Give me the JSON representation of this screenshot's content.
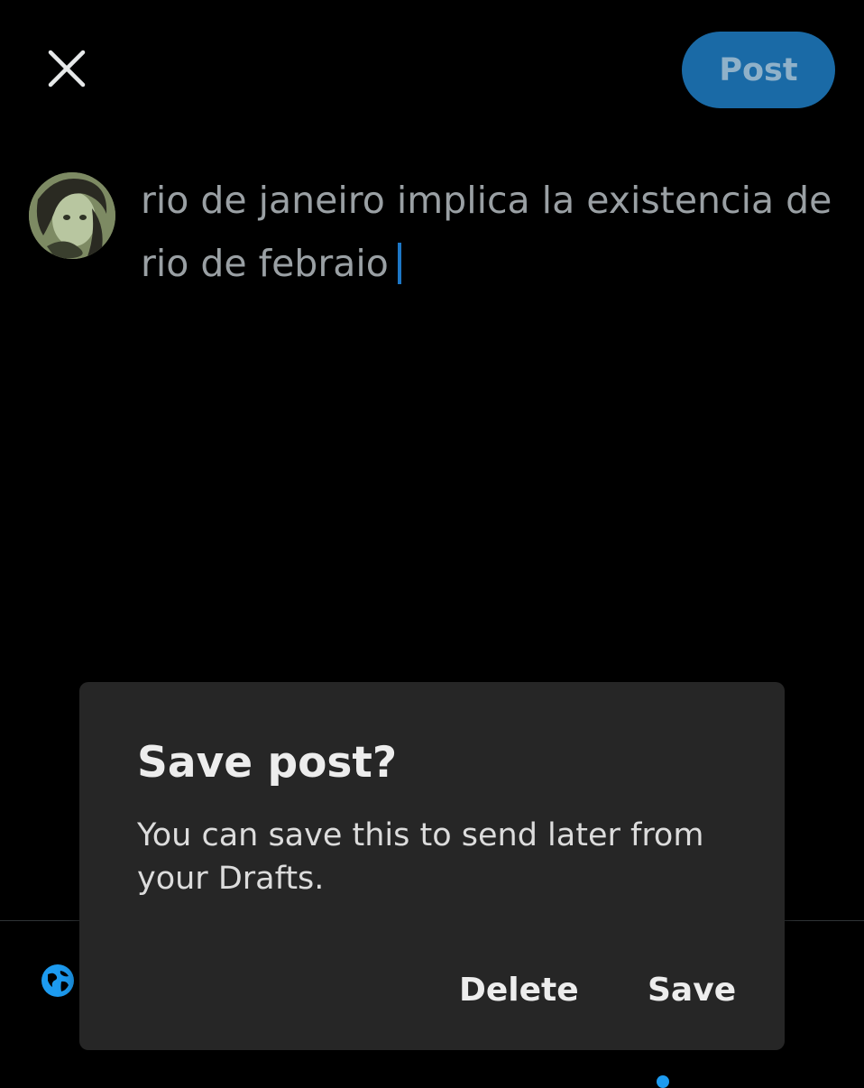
{
  "colors": {
    "accent": "#1d9bf0",
    "post_button_bg": "#1a6aa6",
    "post_button_text": "#8fb1c9",
    "caret": "#1d77c6",
    "dialog_bg": "#262626"
  },
  "header": {
    "close_icon": "close-icon",
    "post_label": "Post"
  },
  "composer": {
    "avatar_icon": "user-avatar",
    "text": "rio de janeiro implica la existencia de rio de febraio"
  },
  "toolbar": {
    "globe_icon": "globe-icon"
  },
  "dialog": {
    "title": "Save post?",
    "body": "You can save this to send later from your Drafts.",
    "delete_label": "Delete",
    "save_label": "Save"
  }
}
